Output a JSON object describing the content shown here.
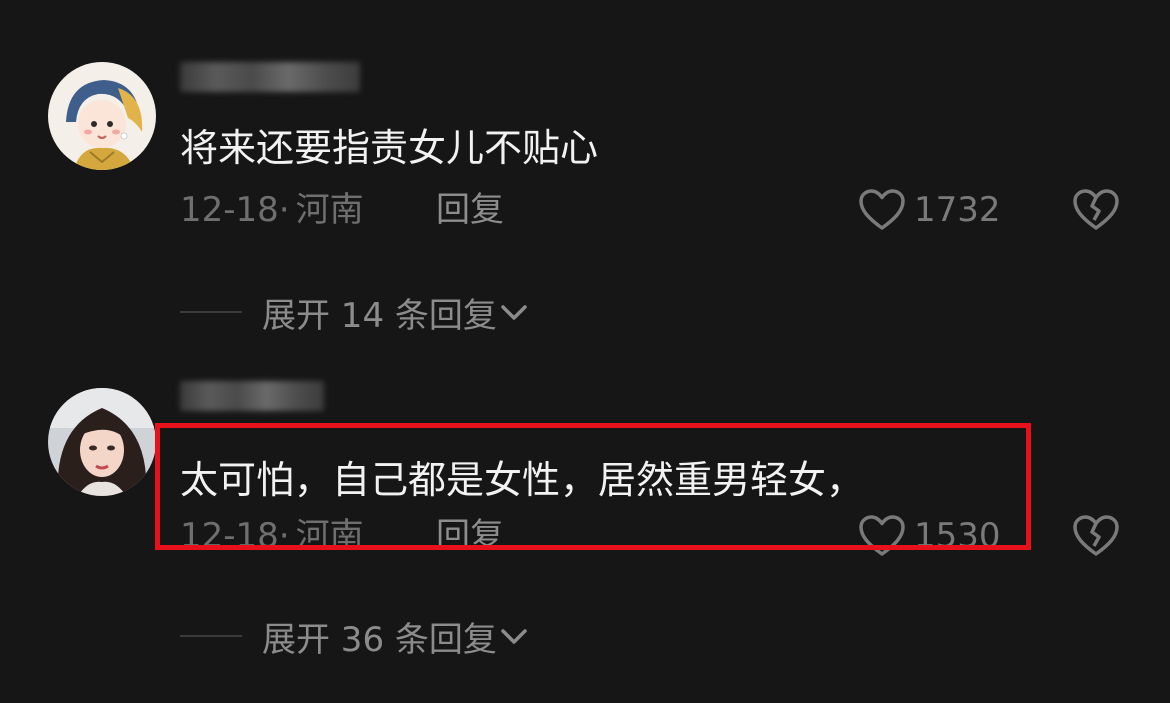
{
  "comments": [
    {
      "text": "将来还要指责女儿不贴心",
      "date": "12-18·",
      "location": "河南",
      "reply_label": "回复",
      "likes": "1732",
      "expand_label": "展开 14 条回复"
    },
    {
      "text": "太可怕，自己都是女性，居然重男轻女，",
      "date": "12-18·",
      "location": "河南",
      "reply_label": "回复",
      "likes": "1530",
      "expand_label": "展开 36 条回复"
    }
  ],
  "icons": {
    "like": "heart-outline-icon",
    "dislike": "broken-heart-icon",
    "expand": "chevron-down-icon"
  },
  "colors": {
    "background": "#161616",
    "highlight": "#e8101a",
    "primary_text": "#f2f2f2",
    "secondary_text": "#6f6f6f"
  }
}
